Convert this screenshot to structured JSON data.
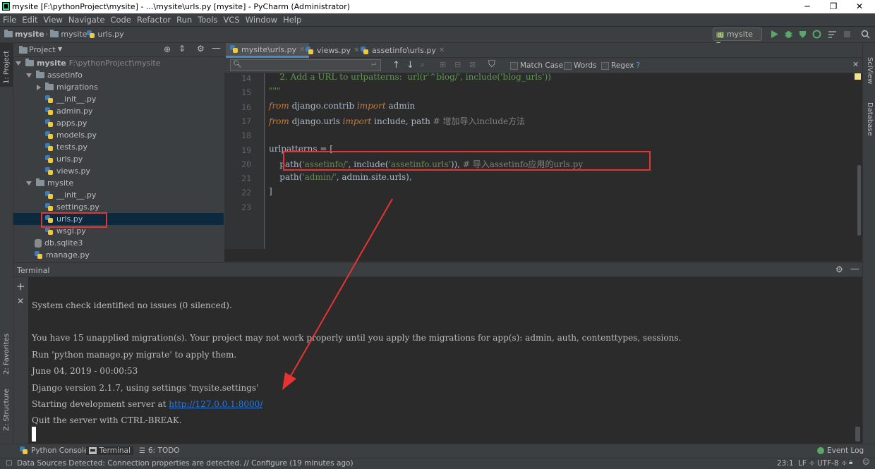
{
  "window": {
    "title": "mysite [F:\\pythonProject\\mysite] - ...\\mysite\\urls.py [mysite] - PyCharm (Administrator)",
    "controls": [
      "─",
      "❐",
      "✕"
    ]
  },
  "menu": [
    "File",
    "Edit",
    "View",
    "Navigate",
    "Code",
    "Refactor",
    "Run",
    "Tools",
    "VCS",
    "Window",
    "Help"
  ],
  "breadcrumb": [
    "mysite",
    "mysite",
    "urls.py"
  ],
  "run_config": "mysite",
  "left_stripe": {
    "project": "1: Project",
    "favorites": "2: Favorites",
    "structure": "Z: Structure"
  },
  "right_stripe": {
    "sciview": "SciView",
    "database": "Database"
  },
  "project_panel": {
    "title": "Project",
    "root_name": "mysite",
    "root_path": "F:\\pythonProject\\mysite",
    "tree": [
      {
        "label": "assetinfo",
        "type": "folder",
        "level": 1,
        "expanded": true
      },
      {
        "label": "migrations",
        "type": "folder",
        "level": 2,
        "expanded": false
      },
      {
        "label": "__init__.py",
        "type": "py",
        "level": 2
      },
      {
        "label": "admin.py",
        "type": "py",
        "level": 2
      },
      {
        "label": "apps.py",
        "type": "py",
        "level": 2
      },
      {
        "label": "models.py",
        "type": "py",
        "level": 2
      },
      {
        "label": "tests.py",
        "type": "py",
        "level": 2
      },
      {
        "label": "urls.py",
        "type": "py",
        "level": 2
      },
      {
        "label": "views.py",
        "type": "py",
        "level": 2
      },
      {
        "label": "mysite",
        "type": "folder",
        "level": 1,
        "expanded": true
      },
      {
        "label": "__init__.py",
        "type": "py",
        "level": 2
      },
      {
        "label": "settings.py",
        "type": "py",
        "level": 2
      },
      {
        "label": "urls.py",
        "type": "py",
        "level": 2,
        "selected": true
      },
      {
        "label": "wsgi.py",
        "type": "py",
        "level": 2
      },
      {
        "label": "db.sqlite3",
        "type": "db",
        "level": 1
      },
      {
        "label": "manage.py",
        "type": "py",
        "level": 1
      }
    ]
  },
  "editor_tabs": [
    {
      "label": "mysite\\urls.py",
      "active": true
    },
    {
      "label": "views.py",
      "active": false
    },
    {
      "label": "assetinfo\\urls.py",
      "active": false
    }
  ],
  "search": {
    "placeholder": "",
    "match_case": "Match Case",
    "words": "Words",
    "regex": "Regex",
    "help": "?"
  },
  "editor": {
    "lines": [
      {
        "n": "14",
        "text": "    2. Add a URL to urlpatterns:  url(r'^blog/', include('blog_urls'))"
      },
      {
        "n": "15",
        "text": "\"\"\""
      },
      {
        "n": "16",
        "text": "from django.contrib import admin"
      },
      {
        "n": "17",
        "text": "from django.urls import include, path # 增加导入include方法"
      },
      {
        "n": "18",
        "text": ""
      },
      {
        "n": "19",
        "text": "urlpatterns = ["
      },
      {
        "n": "20",
        "text": "    path('assetinfo/', include('assetinfo.urls')), # 导入assetinfo应用的urls.py"
      },
      {
        "n": "21",
        "text": "    path('admin/', admin.site.urls),"
      },
      {
        "n": "22",
        "text": "]"
      },
      {
        "n": "23",
        "text": ""
      }
    ]
  },
  "terminal": {
    "title": "Terminal",
    "lines": [
      "System check identified no issues (0 silenced).",
      "",
      "You have 15 unapplied migration(s). Your project may not work properly until you apply the migrations for app(s): admin, auth, contenttypes, sessions.",
      "Run 'python manage.py migrate' to apply them.",
      "June 04, 2019 - 00:00:53",
      "Django version 2.1.7, using settings 'mysite.settings'",
      "Starting development server at ",
      "Quit the server with CTRL-BREAK."
    ],
    "server_url": "http://127.0.0.1:8000/"
  },
  "bottom_tabs": [
    {
      "label": "Python Console",
      "active": false
    },
    {
      "label": "Terminal",
      "active": true
    },
    {
      "label": "6: TODO",
      "active": false
    }
  ],
  "event_log": "Event Log",
  "status": {
    "message": "Data Sources Detected: Connection properties are detected. // Configure (19 minutes ago)",
    "position": "23:1",
    "line_sep": "LF ÷",
    "encoding": "UTF-8 ÷"
  },
  "colors": {
    "annotation": "#e83333",
    "selection": "#0d293e",
    "keyword": "#cc7832",
    "string": "#6a8759"
  }
}
